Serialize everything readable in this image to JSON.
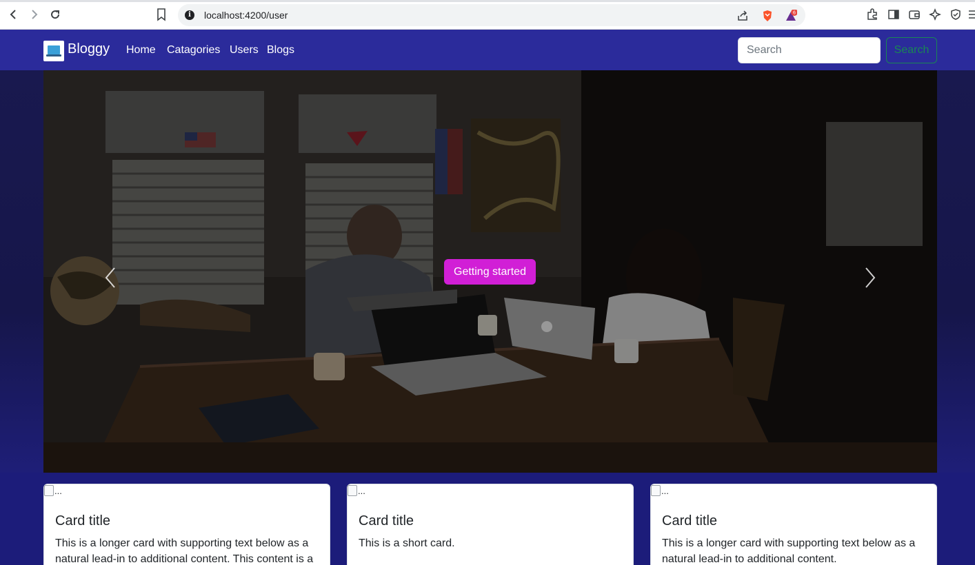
{
  "browser": {
    "url": "localhost:4200/user",
    "brave_badge_count": "6"
  },
  "navbar": {
    "brand": "Bloggy",
    "links": [
      "Home",
      "Catagories",
      "Users",
      "Blogs"
    ],
    "search_placeholder": "Search",
    "search_button": "Search"
  },
  "hero": {
    "cta_label": "Getting started"
  },
  "cards": [
    {
      "img_alt": "...",
      "title": "Card title",
      "text": "This is a longer card with supporting text below as a natural lead-in to additional content. This content is a"
    },
    {
      "img_alt": "...",
      "title": "Card title",
      "text": "This is a short card."
    },
    {
      "img_alt": "...",
      "title": "Card title",
      "text": "This is a longer card with supporting text below as a natural lead-in to additional content."
    }
  ],
  "colors": {
    "navbar": "#2b2b9b",
    "cta": "#d11fd6",
    "search_button": "#198754",
    "page_background": "#1a1a6e"
  }
}
